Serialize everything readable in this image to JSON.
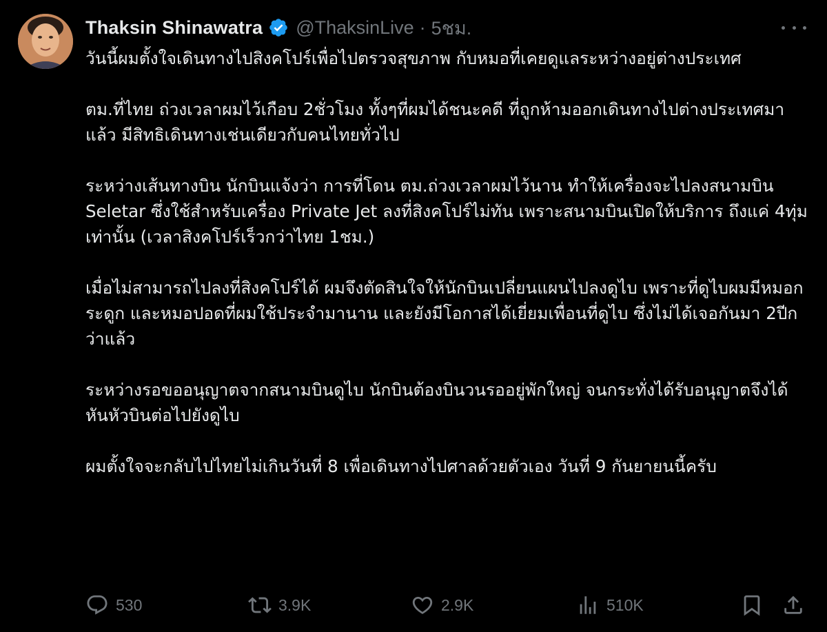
{
  "author": {
    "name": "Thaksin Shinawatra",
    "handle": "@ThaksinLive",
    "separator": "·",
    "time": "5ชม."
  },
  "tweet": {
    "paragraphs": [
      "วันนี้ผมตั้งใจเดินทางไปสิงคโปร์เพื่อไปตรวจสุขภาพ กับหมอที่เคยดูแลระหว่างอยู่ต่างประเทศ",
      "ตม.ที่ไทย ถ่วงเวลาผมไว้เกือบ 2ชั่วโมง ทั้งๆที่ผมได้ชนะคดี ที่ถูกห้ามออกเดินทางไปต่างประเทศมาแล้ว มีสิทธิเดินทางเช่นเดียวกับคนไทยทั่วไป",
      "ระหว่างเส้นทางบิน นักบินแจ้งว่า การที่โดน ตม.ถ่วงเวลาผมไว้นาน ทำให้เครื่องจะไปลงสนามบิน Seletar ซึ่งใช้สำหรับเครื่อง Private Jet ลงที่สิงคโปร์ไม่ทัน เพราะสนามบินเปิดให้บริการ ถึงแค่ 4ทุ่ม เท่านั้น (เวลาสิงคโปร์เร็วกว่าไทย 1ชม.)",
      "เมื่อไม่สามารถไปลงที่สิงคโปร์ได้  ผมจึงตัดสินใจให้นักบินเปลี่ยนแผนไปลงดูไบ เพราะที่ดูไบผมมีหมอกระดูก และหมอปอดที่ผมใช้ประจำมานาน และยังมีโอกาสได้เยี่ยมเพื่อนที่ดูไบ ซึ่งไม่ได้เจอกันมา 2ปีกว่าแล้ว",
      "ระหว่างรอขออนุญาตจากสนามบินดูไบ นักบินต้องบินวนรออยู่พักใหญ่ จนกระทั่งได้รับอนุญาตจึงได้หันหัวบินต่อไปยังดูไบ",
      "ผมตั้งใจจะกลับไปไทยไม่เกินวันที่ 8 เพื่อเดินทางไปศาลด้วยตัวเอง วันที่ 9 กันยายนนี้ครับ"
    ]
  },
  "metrics": {
    "replies": "530",
    "retweets": "3.9K",
    "likes": "2.9K",
    "views": "510K"
  },
  "colors": {
    "background": "#000000",
    "text": "#e7e9ea",
    "muted": "#71767b",
    "verified_badge": "#1d9bf0"
  },
  "icons": {
    "verified": "verified-badge-icon",
    "more": "more-options-icon",
    "reply": "reply-icon",
    "retweet": "retweet-icon",
    "like": "like-icon",
    "views": "views-icon",
    "bookmark": "bookmark-icon",
    "share": "share-icon"
  }
}
